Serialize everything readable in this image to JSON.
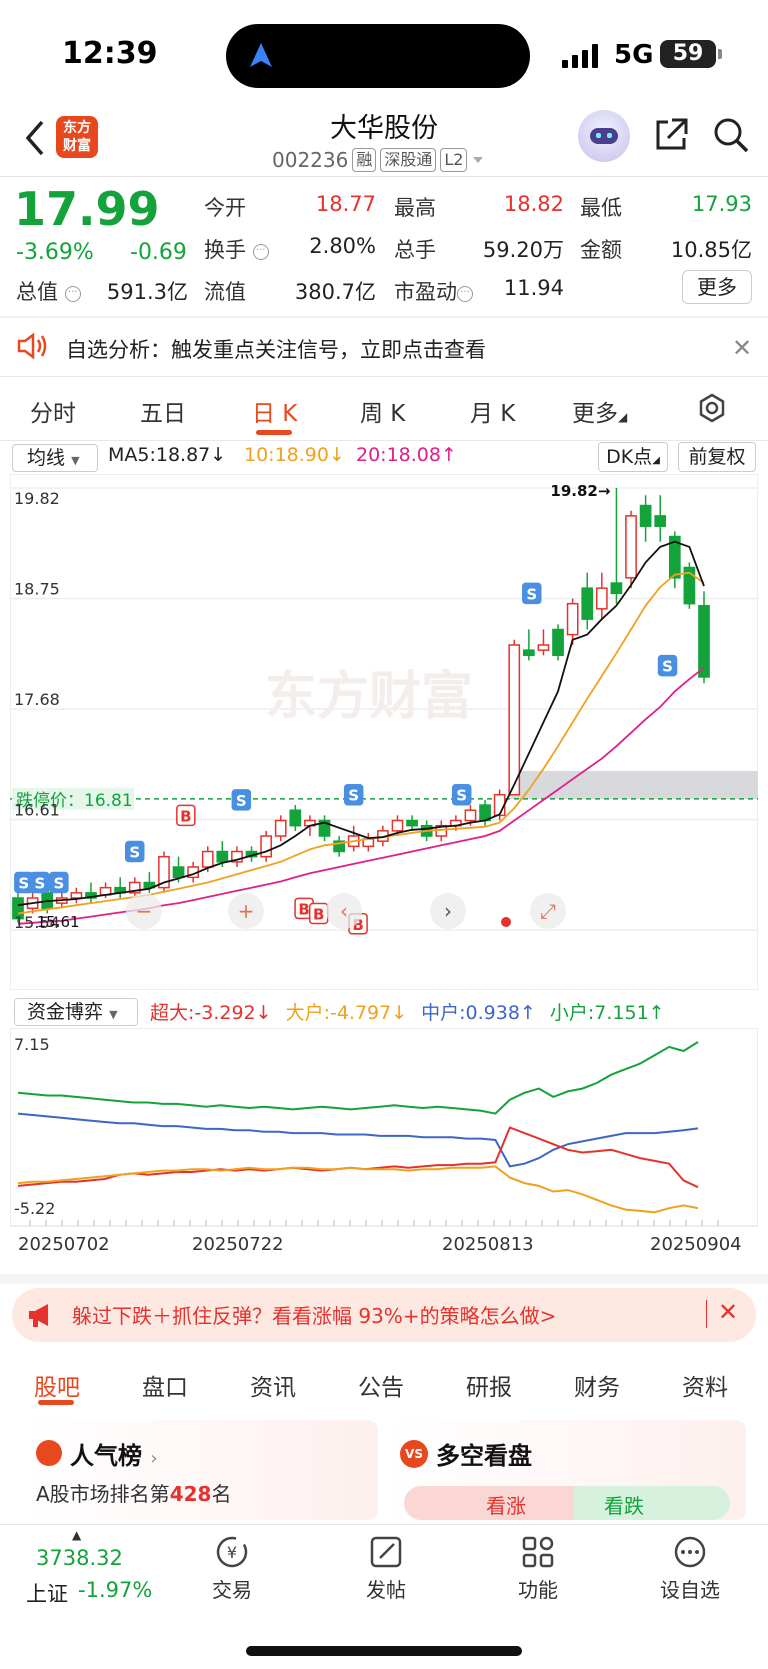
{
  "status_bar": {
    "time": "12:39",
    "network": "5G",
    "battery": "59"
  },
  "header": {
    "logo_line1": "东方",
    "logo_line2": "财富",
    "stock_name": "大华股份",
    "stock_code": "002236",
    "tags": [
      "融",
      "深股通",
      "L2"
    ]
  },
  "quote": {
    "price": "17.99",
    "change_pct": "-3.69%",
    "change_abs": "-0.69",
    "rows": [
      [
        {
          "label": "今开",
          "value": "18.77",
          "color": "red"
        },
        {
          "label": "最高",
          "value": "18.82",
          "color": "red"
        },
        {
          "label": "最低",
          "value": "17.93",
          "color": "green"
        }
      ],
      [
        {
          "label": "换手",
          "value": "2.80%",
          "color": "black",
          "info": true
        },
        {
          "label": "总手",
          "value": "59.20万",
          "color": "black"
        },
        {
          "label": "金额",
          "value": "10.85亿",
          "color": "black"
        }
      ],
      [
        {
          "label": "总值",
          "value": "591.3亿",
          "color": "black",
          "info": true
        },
        {
          "label": "流值",
          "value": "380.7亿",
          "color": "black"
        },
        {
          "label": "市盈动",
          "value": "11.94",
          "color": "black",
          "info": true
        }
      ]
    ],
    "more_label": "更多"
  },
  "analysis_banner": {
    "text": "自选分析：触发重点关注信号，立即点击查看"
  },
  "chart_tabs": [
    "分时",
    "五日",
    "日 K",
    "周 K",
    "月 K",
    "更多"
  ],
  "active_chart_tab": "日 K",
  "ma_bar": {
    "selector": "均线",
    "ma5": "MA5:18.87↓",
    "ma10": "10:18.90↓",
    "ma20": "20:18.08↑",
    "dk_label": "DK点",
    "fq_label": "前复权"
  },
  "kline": {
    "y_labels": [
      "19.82",
      "18.75",
      "17.68",
      "16.61",
      "15.54"
    ],
    "limit_down_label": "跌停价：16.81",
    "high_marker": "19.82→",
    "low_marker": "15.61",
    "watermark": "东方财富"
  },
  "fund_flow": {
    "selector": "资金博弈",
    "legend": [
      {
        "text": "超大:-3.292↓",
        "color": "#e5322d"
      },
      {
        "text": "大户:-4.797↓",
        "color": "#f0a11d"
      },
      {
        "text": "中户:0.938↑",
        "color": "#3d66c7"
      },
      {
        "text": "小户:7.151↑",
        "color": "#14a33b"
      }
    ],
    "y_max": "7.15",
    "y_min": "-5.22"
  },
  "dates": [
    "20250702",
    "20250722",
    "20250813",
    "20250904"
  ],
  "chart_data": [
    {
      "type": "candlestick",
      "ylim": [
        15.54,
        19.82
      ],
      "limit_down": 16.81,
      "candles": [
        {
          "o": 15.85,
          "c": 15.65,
          "h": 15.9,
          "l": 15.61
        },
        {
          "o": 15.75,
          "c": 15.85,
          "h": 15.95,
          "l": 15.7
        },
        {
          "o": 15.9,
          "c": 15.75,
          "h": 16.0,
          "l": 15.7
        },
        {
          "o": 15.8,
          "c": 15.85,
          "h": 15.95,
          "l": 15.75
        },
        {
          "o": 15.85,
          "c": 15.9,
          "h": 15.95,
          "l": 15.8
        },
        {
          "o": 15.9,
          "c": 15.85,
          "h": 16.0,
          "l": 15.8
        },
        {
          "o": 15.88,
          "c": 15.95,
          "h": 16.0,
          "l": 15.85
        },
        {
          "o": 15.95,
          "c": 15.9,
          "h": 16.05,
          "l": 15.85
        },
        {
          "o": 15.9,
          "c": 16.0,
          "h": 16.05,
          "l": 15.85
        },
        {
          "o": 16.0,
          "c": 15.95,
          "h": 16.1,
          "l": 15.9
        },
        {
          "o": 15.95,
          "c": 16.25,
          "h": 16.3,
          "l": 15.9
        },
        {
          "o": 16.15,
          "c": 16.05,
          "h": 16.25,
          "l": 16.0
        },
        {
          "o": 16.05,
          "c": 16.15,
          "h": 16.2,
          "l": 16.0
        },
        {
          "o": 16.15,
          "c": 16.3,
          "h": 16.35,
          "l": 16.1
        },
        {
          "o": 16.3,
          "c": 16.2,
          "h": 16.4,
          "l": 16.15
        },
        {
          "o": 16.2,
          "c": 16.3,
          "h": 16.35,
          "l": 16.15
        },
        {
          "o": 16.3,
          "c": 16.25,
          "h": 16.35,
          "l": 16.2
        },
        {
          "o": 16.25,
          "c": 16.45,
          "h": 16.5,
          "l": 16.2
        },
        {
          "o": 16.45,
          "c": 16.6,
          "h": 16.65,
          "l": 16.4
        },
        {
          "o": 16.7,
          "c": 16.55,
          "h": 16.75,
          "l": 16.5
        },
        {
          "o": 16.55,
          "c": 16.6,
          "h": 16.65,
          "l": 16.45
        },
        {
          "o": 16.6,
          "c": 16.45,
          "h": 16.65,
          "l": 16.4
        },
        {
          "o": 16.4,
          "c": 16.3,
          "h": 16.45,
          "l": 16.25
        },
        {
          "o": 16.35,
          "c": 16.45,
          "h": 16.55,
          "l": 16.3
        },
        {
          "o": 16.35,
          "c": 16.42,
          "h": 16.48,
          "l": 16.3
        },
        {
          "o": 16.4,
          "c": 16.5,
          "h": 16.55,
          "l": 16.35
        },
        {
          "o": 16.5,
          "c": 16.6,
          "h": 16.65,
          "l": 16.45
        },
        {
          "o": 16.6,
          "c": 16.55,
          "h": 16.65,
          "l": 16.5
        },
        {
          "o": 16.55,
          "c": 16.45,
          "h": 16.6,
          "l": 16.4
        },
        {
          "o": 16.45,
          "c": 16.55,
          "h": 16.6,
          "l": 16.4
        },
        {
          "o": 16.55,
          "c": 16.6,
          "h": 16.65,
          "l": 16.5
        },
        {
          "o": 16.6,
          "c": 16.7,
          "h": 16.75,
          "l": 16.55
        },
        {
          "o": 16.75,
          "c": 16.6,
          "h": 16.8,
          "l": 16.55
        },
        {
          "o": 16.65,
          "c": 16.85,
          "h": 16.9,
          "l": 16.6
        },
        {
          "o": 16.85,
          "c": 18.3,
          "h": 18.35,
          "l": 16.85
        },
        {
          "o": 18.25,
          "c": 18.2,
          "h": 18.45,
          "l": 18.15
        },
        {
          "o": 18.25,
          "c": 18.3,
          "h": 18.45,
          "l": 18.2
        },
        {
          "o": 18.45,
          "c": 18.2,
          "h": 18.5,
          "l": 18.15
        },
        {
          "o": 18.4,
          "c": 18.7,
          "h": 18.75,
          "l": 18.3
        },
        {
          "o": 18.85,
          "c": 18.55,
          "h": 19.0,
          "l": 18.45
        },
        {
          "o": 18.65,
          "c": 18.85,
          "h": 19.0,
          "l": 18.55
        },
        {
          "o": 18.9,
          "c": 18.8,
          "h": 19.82,
          "l": 18.7
        },
        {
          "o": 18.95,
          "c": 19.55,
          "h": 19.6,
          "l": 18.85
        },
        {
          "o": 19.65,
          "c": 19.45,
          "h": 19.75,
          "l": 19.3
        },
        {
          "o": 19.55,
          "c": 19.45,
          "h": 19.75,
          "l": 19.3
        },
        {
          "o": 19.35,
          "c": 18.95,
          "h": 19.4,
          "l": 18.85
        },
        {
          "o": 19.05,
          "c": 18.7,
          "h": 19.1,
          "l": 18.65
        },
        {
          "o": 18.68,
          "c": 17.99,
          "h": 18.82,
          "l": 17.93
        }
      ],
      "ma5": [
        15.78,
        15.8,
        15.82,
        15.83,
        15.84,
        15.86,
        15.88,
        15.9,
        15.92,
        15.94,
        16.0,
        16.04,
        16.08,
        16.14,
        16.19,
        16.22,
        16.26,
        16.3,
        16.36,
        16.45,
        16.55,
        16.58,
        16.53,
        16.48,
        16.43,
        16.44,
        16.48,
        16.51,
        16.52,
        16.54,
        16.55,
        16.58,
        16.6,
        16.66,
        16.95,
        17.25,
        17.55,
        17.85,
        18.35,
        18.4,
        18.55,
        18.68,
        18.88,
        19.1,
        19.25,
        19.3,
        19.25,
        18.87
      ],
      "ma10": [
        15.7,
        15.72,
        15.74,
        15.76,
        15.78,
        15.8,
        15.82,
        15.84,
        15.86,
        15.88,
        15.91,
        15.94,
        15.97,
        16.0,
        16.04,
        16.08,
        16.12,
        16.16,
        16.2,
        16.26,
        16.32,
        16.36,
        16.38,
        16.4,
        16.42,
        16.44,
        16.46,
        16.48,
        16.5,
        16.51,
        16.52,
        16.53,
        16.54,
        16.58,
        16.72,
        16.9,
        17.1,
        17.32,
        17.55,
        17.78,
        18.0,
        18.22,
        18.45,
        18.68,
        18.86,
        18.98,
        19.0,
        18.9
      ],
      "ma20": [
        15.6,
        15.61,
        15.62,
        15.63,
        15.65,
        15.67,
        15.69,
        15.71,
        15.73,
        15.75,
        15.78,
        15.8,
        15.83,
        15.86,
        15.89,
        15.92,
        15.95,
        15.98,
        16.01,
        16.05,
        16.09,
        16.12,
        16.15,
        16.18,
        16.21,
        16.24,
        16.27,
        16.3,
        16.33,
        16.36,
        16.39,
        16.42,
        16.45,
        16.5,
        16.6,
        16.7,
        16.8,
        16.9,
        17.0,
        17.1,
        17.2,
        17.32,
        17.45,
        17.58,
        17.7,
        17.85,
        17.97,
        18.08
      ]
    },
    {
      "type": "line",
      "title": "资金博弈",
      "ylim": [
        -5.22,
        7.15
      ],
      "series": [
        {
          "name": "小户",
          "color": "#14a33b",
          "values": [
            3.5,
            3.4,
            3.3,
            3.3,
            3.2,
            3.1,
            3.0,
            2.9,
            2.8,
            2.8,
            2.7,
            2.7,
            2.6,
            2.5,
            2.6,
            2.5,
            2.4,
            2.5,
            2.4,
            2.3,
            2.4,
            2.5,
            2.4,
            2.3,
            2.4,
            2.5,
            2.6,
            2.5,
            2.4,
            2.5,
            2.4,
            2.3,
            2.2,
            2.0,
            3.0,
            3.5,
            3.8,
            3.2,
            3.6,
            3.8,
            4.2,
            4.8,
            5.2,
            5.6,
            6.2,
            6.8,
            6.5,
            7.15
          ]
        },
        {
          "name": "中户",
          "color": "#3d66c7",
          "values": [
            2.0,
            1.9,
            1.8,
            1.7,
            1.6,
            1.5,
            1.4,
            1.3,
            1.3,
            1.2,
            1.1,
            1.1,
            1.0,
            0.9,
            0.9,
            0.8,
            0.8,
            0.7,
            0.7,
            0.6,
            0.6,
            0.6,
            0.5,
            0.5,
            0.5,
            0.4,
            0.4,
            0.4,
            0.3,
            0.3,
            0.3,
            0.2,
            0.2,
            0.1,
            -1.8,
            -1.6,
            -1.2,
            -0.6,
            -0.2,
            0.0,
            0.2,
            0.4,
            0.6,
            0.6,
            0.6,
            0.7,
            0.8,
            0.938
          ]
        },
        {
          "name": "超大",
          "color": "#e5322d",
          "values": [
            -3.2,
            -3.1,
            -3.0,
            -2.9,
            -2.9,
            -2.8,
            -2.7,
            -2.4,
            -2.3,
            -2.4,
            -2.3,
            -2.2,
            -2.2,
            -2.1,
            -2.0,
            -2.1,
            -2.0,
            -2.1,
            -2.0,
            -1.9,
            -2.0,
            -2.1,
            -2.0,
            -1.9,
            -2.0,
            -1.9,
            -1.8,
            -1.9,
            -1.8,
            -1.7,
            -1.7,
            -1.6,
            -1.6,
            -1.5,
            1.0,
            0.6,
            0.2,
            -0.2,
            -0.6,
            -0.8,
            -0.7,
            -0.6,
            -0.9,
            -1.2,
            -1.4,
            -1.6,
            -2.8,
            -3.292
          ]
        },
        {
          "name": "大户",
          "color": "#f0a11d",
          "values": [
            -3.0,
            -2.9,
            -2.9,
            -2.8,
            -2.7,
            -2.6,
            -2.5,
            -2.4,
            -2.3,
            -2.2,
            -2.1,
            -2.1,
            -2.0,
            -2.0,
            -2.1,
            -2.0,
            -1.9,
            -2.0,
            -2.0,
            -1.9,
            -1.9,
            -2.0,
            -2.0,
            -1.9,
            -2.0,
            -2.0,
            -2.0,
            -2.1,
            -2.0,
            -2.0,
            -1.9,
            -1.9,
            -1.9,
            -1.8,
            -2.6,
            -3.0,
            -3.2,
            -3.6,
            -3.5,
            -3.8,
            -4.2,
            -4.6,
            -4.9,
            -5.0,
            -5.1,
            -4.8,
            -4.6,
            -4.797
          ]
        }
      ]
    }
  ],
  "promo": {
    "text": "躲过下跌＋抓住反弹？看看涨幅 93%+的策略怎么做>"
  },
  "news_tabs": [
    "股吧",
    "盘口",
    "资讯",
    "公告",
    "研报",
    "财务",
    "资料"
  ],
  "active_news_tab": "股吧",
  "cards": {
    "hot": {
      "title": "人气榜",
      "rank_prefix": "A股市场排名第",
      "rank": "428",
      "rank_suffix": "名"
    },
    "bull_bear": {
      "title": "多空看盘",
      "up": "看涨",
      "down": "看跌"
    }
  },
  "bottom_nav": {
    "index_value": "3738.32",
    "index_name": "上证",
    "index_chg": "-1.97%",
    "items": [
      "交易",
      "发帖",
      "功能",
      "设自选"
    ]
  }
}
